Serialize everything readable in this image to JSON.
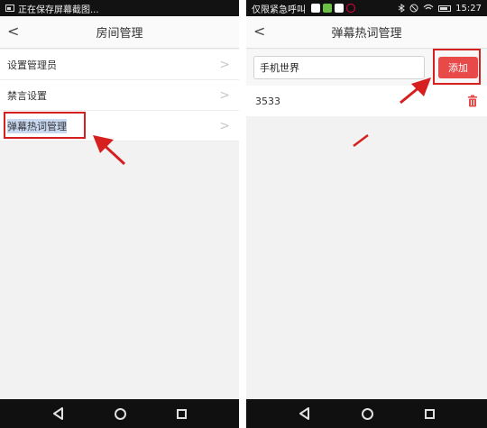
{
  "left": {
    "status_text": "正在保存屏幕截图...",
    "back_glyph": "<",
    "title": "房间管理",
    "menu_items": [
      {
        "label": "设置管理员",
        "chev": ">"
      },
      {
        "label": "禁言设置",
        "chev": ">"
      },
      {
        "label": "弹幕热词管理",
        "chev": ">"
      }
    ]
  },
  "right": {
    "status_left": "仅限紧急呼叫",
    "status_time": "15:27",
    "back_glyph": "<",
    "title": "弹幕热词管理",
    "input_value": "手机世界",
    "add_button": "添加",
    "keywords": [
      "3533"
    ]
  },
  "colors": {
    "accent": "#e84a4a",
    "annotation": "#d61f1f",
    "highlight": "#c9d9f2"
  },
  "icons": {
    "back": "chevron-left-icon",
    "row": "chevron-right-icon",
    "delete": "trash-icon",
    "nav": [
      "back-triangle-icon",
      "home-circle-icon",
      "recent-square-icon"
    ]
  }
}
